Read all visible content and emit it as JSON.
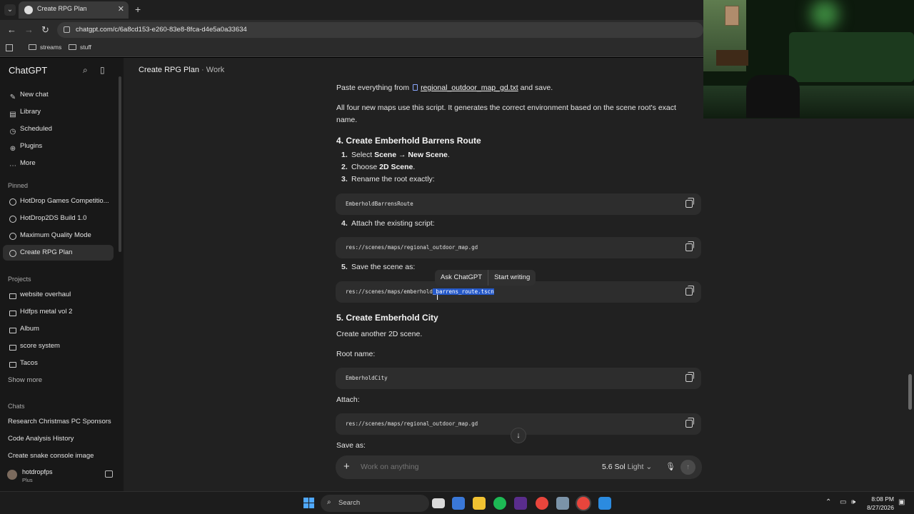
{
  "browser": {
    "tab_title": "Create RPG Plan",
    "new_tab": "+",
    "url": "chatgpt.com/c/6a8cd153-e260-83e8-8fca-d4e5a0a33634",
    "bookmarks": [
      "streams",
      "stuff"
    ]
  },
  "sidebar": {
    "brand": "ChatGPT",
    "nav": [
      "New chat",
      "Library",
      "Scheduled",
      "Plugins",
      "More"
    ],
    "pinned_header": "Pinned",
    "pinned": [
      "HotDrop Games Competitio...",
      "HotDrop2DS Build 1.0",
      "Maximum Quality Mode",
      "Create RPG Plan"
    ],
    "projects_header": "Projects",
    "projects": [
      "website overhaul",
      "Hdfps metal vol 2",
      "Album",
      "score system",
      "Tacos"
    ],
    "show_more": "Show more",
    "chats_header": "Chats",
    "chats": [
      "Research Christmas PC Sponsors",
      "Code Analysis History",
      "Create snake console image"
    ],
    "user_name": "hotdropfps",
    "user_plan": "Plus"
  },
  "main": {
    "title": "Create RPG Plan",
    "separator": "·",
    "subtitle": "Work",
    "paste_pre": "Paste everything from",
    "paste_file": "regional_outdoor_map_gd.txt",
    "paste_post": "and save.",
    "intro": "All four new maps use this script. It generates the correct environment based on the scene root's exact name.",
    "h4": "4. Create Emberhold Barrens Route",
    "step1_num": "1.",
    "step1_pre": "Select ",
    "step1_b1": "Scene",
    "step1_mid": " → ",
    "step1_b2": "New Scene",
    "step1_post": ".",
    "step2_num": "2.",
    "step2_pre": "Choose ",
    "step2_b": "2D Scene",
    "step2_post": ".",
    "step3_num": "3.",
    "step3": "Rename the root exactly:",
    "code1": "EmberholdBarrensRoute",
    "step4_num": "4.",
    "step4": "Attach the existing script:",
    "code2": "res://scenes/maps/regional_outdoor_map.gd",
    "step5_num": "5.",
    "step5": "Save the scene as:",
    "code3_pre": "res://scenes/maps/emberhold",
    "code3_sel": "_barrens_route.tscn",
    "popover_ask": "Ask ChatGPT",
    "popover_write": "Start writing",
    "h5": "5. Create Emberhold City",
    "another": "Create another 2D scene.",
    "root_name": "Root name:",
    "code4": "EmberholdCity",
    "attach": "Attach:",
    "code5": "res://scenes/maps/regional_outdoor_map.gd",
    "save_as": "Save as:",
    "composer_placeholder": "Work on anything",
    "model": "5.6 Sol",
    "model_mode": "Light"
  },
  "taskbar": {
    "search": "Search",
    "time": "8:08 PM",
    "date": "8/27/2026"
  }
}
